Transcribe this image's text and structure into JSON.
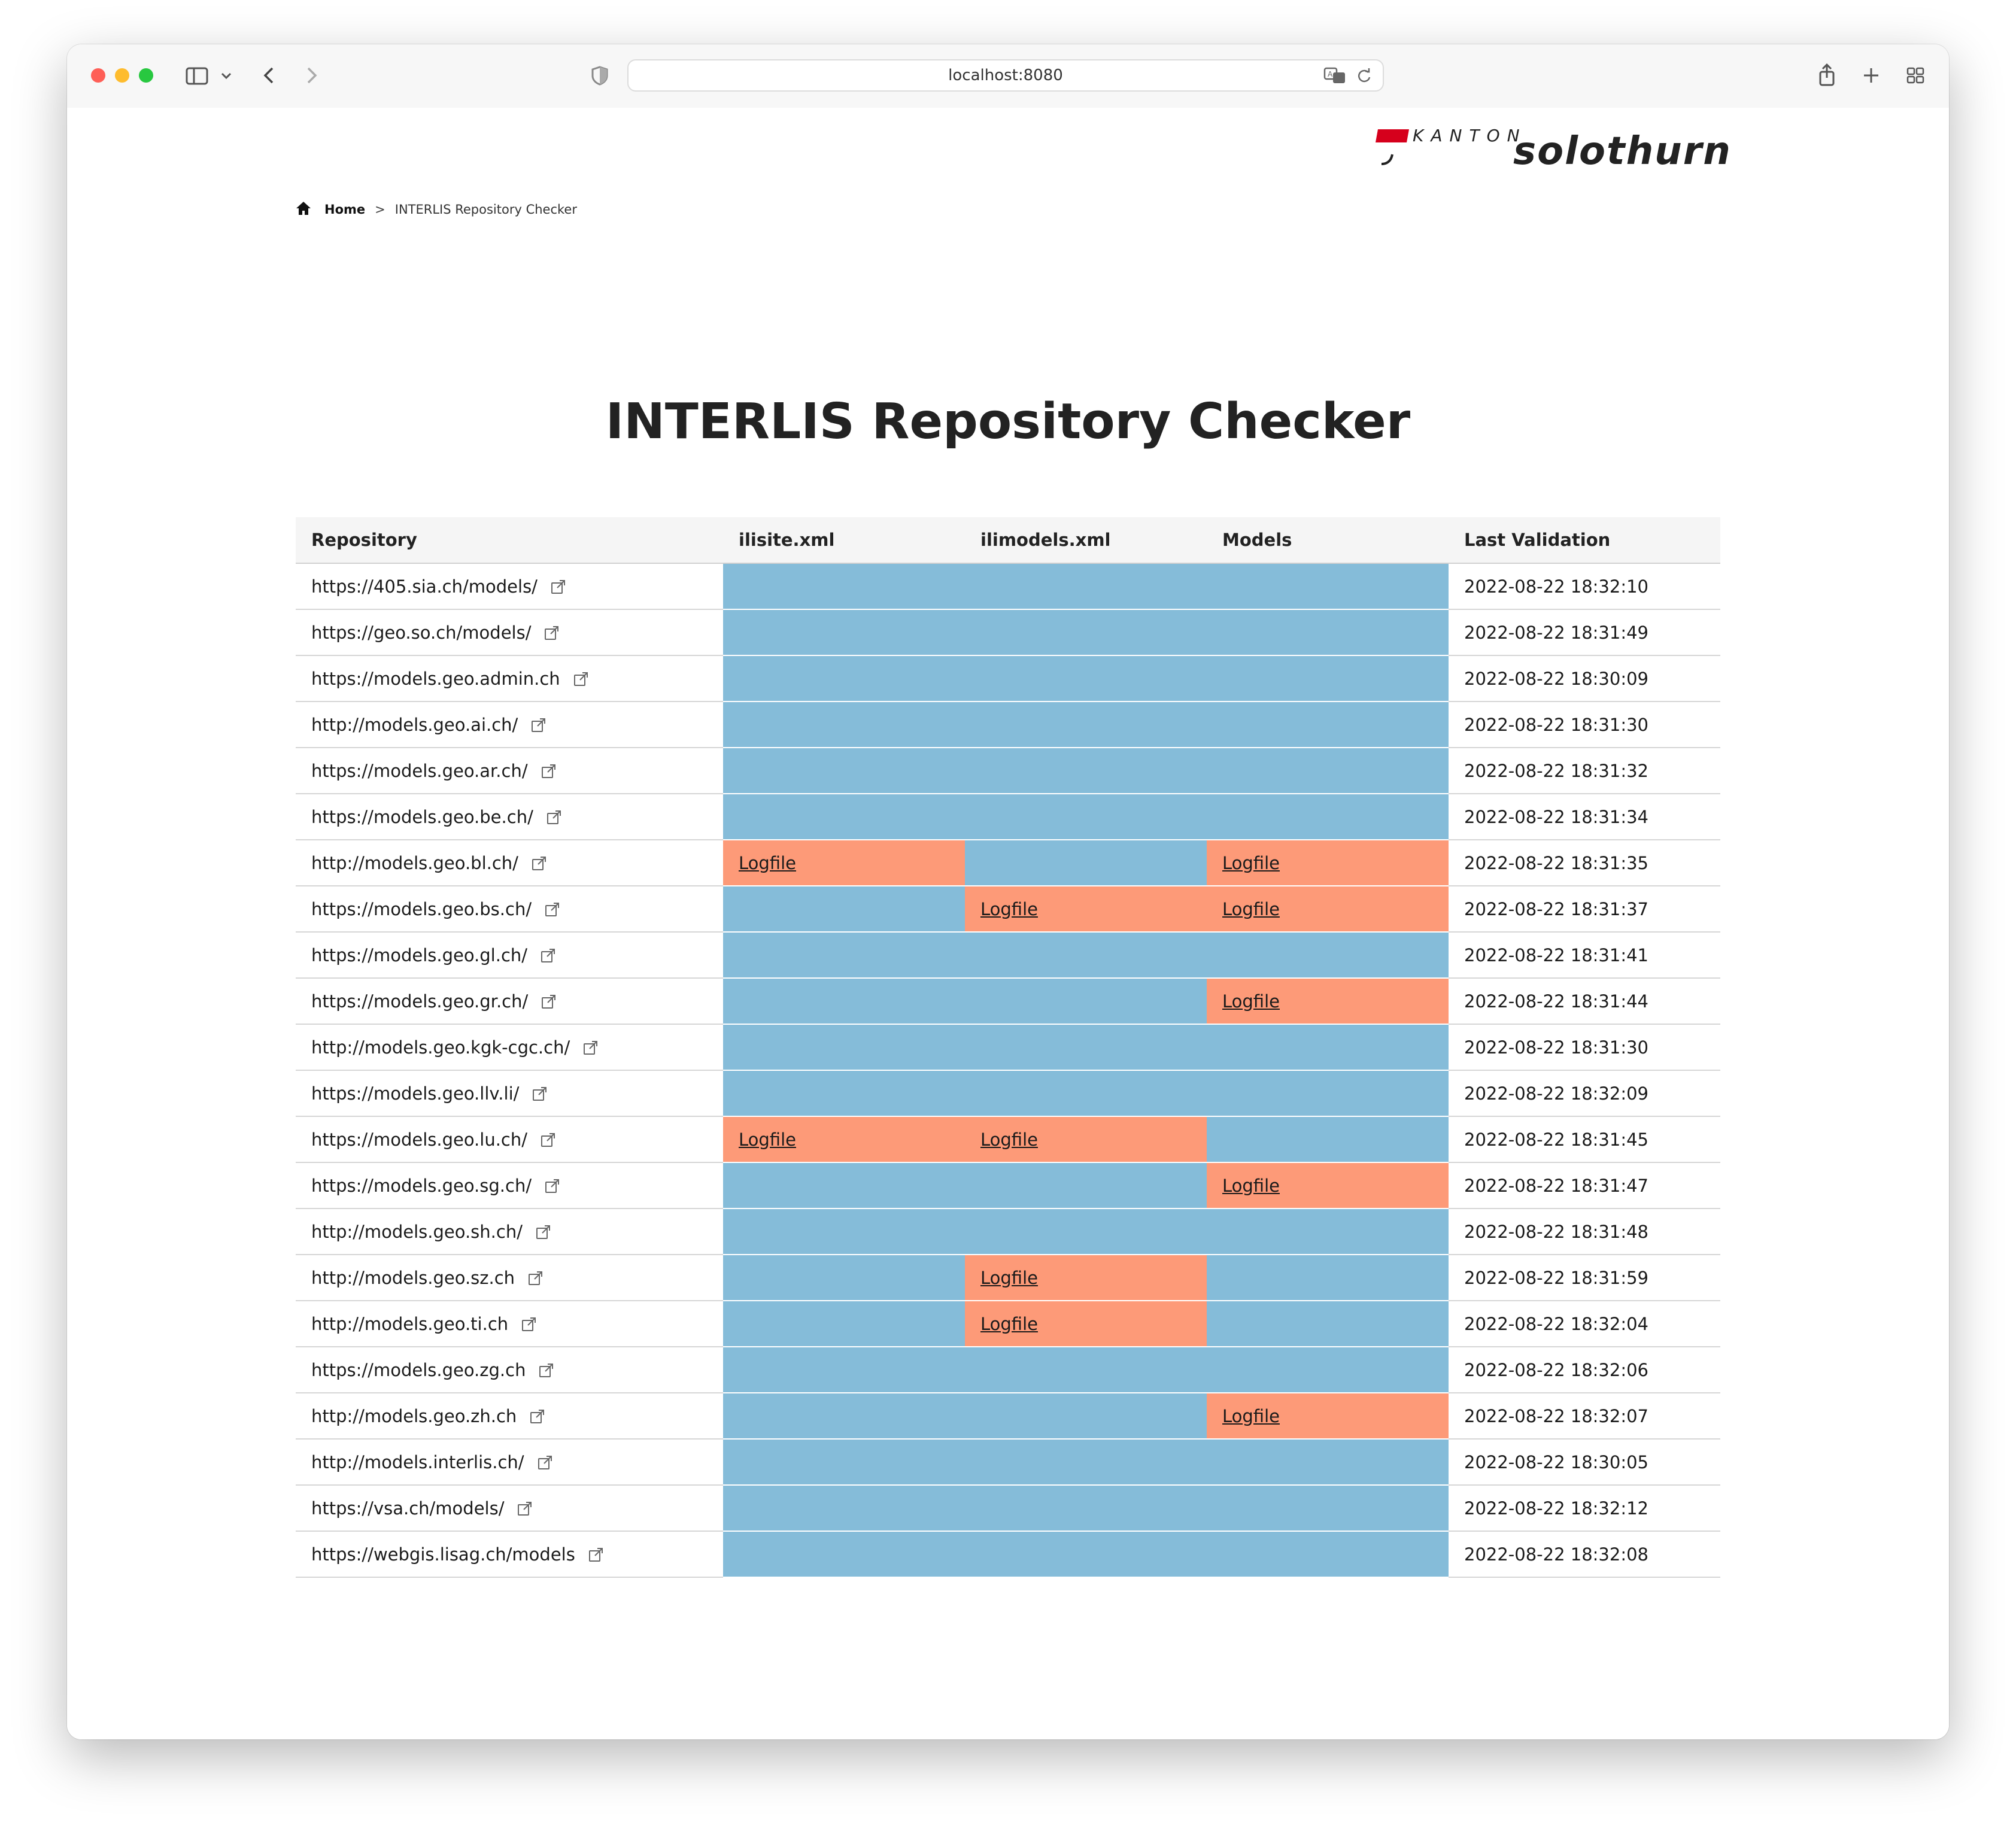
{
  "browser": {
    "url": "localhost:8080"
  },
  "logo": {
    "kanton": "KANTON",
    "name": "solothurn"
  },
  "breadcrumb": {
    "home": "Home",
    "separator": ">",
    "current": "INTERLIS Repository Checker"
  },
  "page": {
    "title": "INTERLIS Repository Checker"
  },
  "table": {
    "headers": {
      "repository": "Repository",
      "ilisite": "ilisite.xml",
      "ilimodels": "ilimodels.xml",
      "models": "Models",
      "last_validation": "Last Validation"
    },
    "logfile_label": "Logfile",
    "colors": {
      "ok": "#85bcd9",
      "error": "#fd9a78"
    },
    "rows": [
      {
        "repo": "https://405.sia.ch/models/",
        "ilisite": "ok",
        "ilimodels": "ok",
        "models": "ok",
        "last": "2022-08-22 18:32:10"
      },
      {
        "repo": "https://geo.so.ch/models/",
        "ilisite": "ok",
        "ilimodels": "ok",
        "models": "ok",
        "last": "2022-08-22 18:31:49"
      },
      {
        "repo": "https://models.geo.admin.ch",
        "ilisite": "ok",
        "ilimodels": "ok",
        "models": "ok",
        "last": "2022-08-22 18:30:09"
      },
      {
        "repo": "http://models.geo.ai.ch/",
        "ilisite": "ok",
        "ilimodels": "ok",
        "models": "ok",
        "last": "2022-08-22 18:31:30"
      },
      {
        "repo": "https://models.geo.ar.ch/",
        "ilisite": "ok",
        "ilimodels": "ok",
        "models": "ok",
        "last": "2022-08-22 18:31:32"
      },
      {
        "repo": "https://models.geo.be.ch/",
        "ilisite": "ok",
        "ilimodels": "ok",
        "models": "ok",
        "last": "2022-08-22 18:31:34"
      },
      {
        "repo": "http://models.geo.bl.ch/",
        "ilisite": "error",
        "ilimodels": "ok",
        "models": "error",
        "last": "2022-08-22 18:31:35"
      },
      {
        "repo": "https://models.geo.bs.ch/",
        "ilisite": "ok",
        "ilimodels": "error",
        "models": "error",
        "last": "2022-08-22 18:31:37"
      },
      {
        "repo": "https://models.geo.gl.ch/",
        "ilisite": "ok",
        "ilimodels": "ok",
        "models": "ok",
        "last": "2022-08-22 18:31:41"
      },
      {
        "repo": "https://models.geo.gr.ch/",
        "ilisite": "ok",
        "ilimodels": "ok",
        "models": "error",
        "last": "2022-08-22 18:31:44"
      },
      {
        "repo": "http://models.geo.kgk-cgc.ch/",
        "ilisite": "ok",
        "ilimodels": "ok",
        "models": "ok",
        "last": "2022-08-22 18:31:30"
      },
      {
        "repo": "https://models.geo.llv.li/",
        "ilisite": "ok",
        "ilimodels": "ok",
        "models": "ok",
        "last": "2022-08-22 18:32:09"
      },
      {
        "repo": "https://models.geo.lu.ch/",
        "ilisite": "error",
        "ilimodels": "error",
        "models": "ok",
        "last": "2022-08-22 18:31:45"
      },
      {
        "repo": "https://models.geo.sg.ch/",
        "ilisite": "ok",
        "ilimodels": "ok",
        "models": "error",
        "last": "2022-08-22 18:31:47"
      },
      {
        "repo": "http://models.geo.sh.ch/",
        "ilisite": "ok",
        "ilimodels": "ok",
        "models": "ok",
        "last": "2022-08-22 18:31:48"
      },
      {
        "repo": "http://models.geo.sz.ch",
        "ilisite": "ok",
        "ilimodels": "error",
        "models": "ok",
        "last": "2022-08-22 18:31:59"
      },
      {
        "repo": "http://models.geo.ti.ch",
        "ilisite": "ok",
        "ilimodels": "error",
        "models": "ok",
        "last": "2022-08-22 18:32:04"
      },
      {
        "repo": "https://models.geo.zg.ch",
        "ilisite": "ok",
        "ilimodels": "ok",
        "models": "ok",
        "last": "2022-08-22 18:32:06"
      },
      {
        "repo": "http://models.geo.zh.ch",
        "ilisite": "ok",
        "ilimodels": "ok",
        "models": "error",
        "last": "2022-08-22 18:32:07"
      },
      {
        "repo": "http://models.interlis.ch/",
        "ilisite": "ok",
        "ilimodels": "ok",
        "models": "ok",
        "last": "2022-08-22 18:30:05"
      },
      {
        "repo": "https://vsa.ch/models/",
        "ilisite": "ok",
        "ilimodels": "ok",
        "models": "ok",
        "last": "2022-08-22 18:32:12"
      },
      {
        "repo": "https://webgis.lisag.ch/models",
        "ilisite": "ok",
        "ilimodels": "ok",
        "models": "ok",
        "last": "2022-08-22 18:32:08"
      }
    ]
  }
}
